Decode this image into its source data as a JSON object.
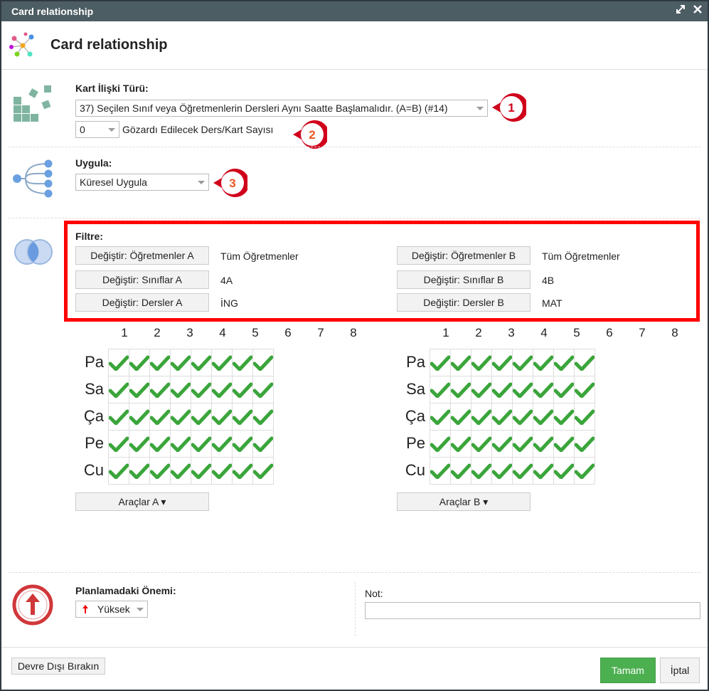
{
  "window": {
    "title": "Card relationship"
  },
  "header": {
    "title": "Card relationship"
  },
  "relation": {
    "label": "Kart İlişki Türü:",
    "type_value": "37) Seçilen Sınıf veya Öğretmenlerin Dersleri Aynı Saatte Başlamalıdır. (A=B) (#14)",
    "ignore_value": "0",
    "ignore_label": "Gözardı Edilecek Ders/Kart Sayısı"
  },
  "apply": {
    "label": "Uygula:",
    "value": "Küresel Uygula"
  },
  "badges": [
    "1",
    "2",
    "3"
  ],
  "filter": {
    "label": "Filtre:",
    "a": [
      {
        "button": "Değiştir: Öğretmenler A",
        "value": "Tüm Öğretmenler"
      },
      {
        "button": "Değiştir: Sınıflar A",
        "value": "4A"
      },
      {
        "button": "Değiştir: Dersler A",
        "value": "İNG"
      }
    ],
    "b": [
      {
        "button": "Değiştir: Öğretmenler B",
        "value": "Tüm Öğretmenler"
      },
      {
        "button": "Değiştir: Sınıflar B",
        "value": "4B"
      },
      {
        "button": "Değiştir: Dersler B",
        "value": "MAT"
      }
    ]
  },
  "grid": {
    "periods": [
      "1",
      "2",
      "3",
      "4",
      "5",
      "6",
      "7",
      "8"
    ],
    "days": [
      "Pa",
      "Sa",
      "Ça",
      "Pe",
      "Cu"
    ],
    "check_color": "#3aa53a"
  },
  "tools": {
    "a": "Araçlar A ▾",
    "b": "Araçlar B ▾"
  },
  "importance": {
    "label": "Planlamadaki Önemi:",
    "value": "Yüksek"
  },
  "note": {
    "label": "Not:",
    "value": ""
  },
  "footer": {
    "disable": "Devre Dışı Bırakın",
    "ok": "Tamam",
    "cancel": "İptal"
  },
  "colors": {
    "titlebar": "#4d5d64",
    "ok": "#4caf50",
    "highlight": "#ff0000",
    "badge": "#d0021b"
  }
}
